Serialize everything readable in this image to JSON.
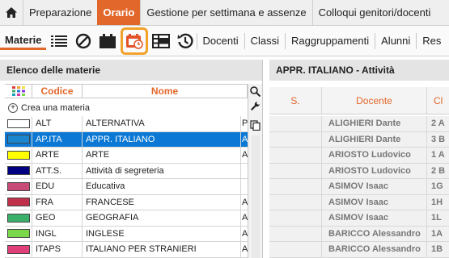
{
  "menu": {
    "home_icon": "home-icon",
    "items": [
      "Preparazione",
      "Orario",
      "Gestione per settimana e assenze",
      "Colloqui genitori/docenti"
    ],
    "active_index": 1
  },
  "toolbar": {
    "section_label": "Materie",
    "icons": [
      "list-icon",
      "ban-icon",
      "calendar-icon",
      "red-calendar-clock-icon",
      "grid-icon",
      "history-icon"
    ],
    "selected_icon_index": 3,
    "links": [
      "Docenti",
      "Classi",
      "Raggruppamenti",
      "Alunni",
      "Res"
    ]
  },
  "left_panel": {
    "title": "Elenco delle materie",
    "columns": {
      "code": "Codice",
      "name": "Nome"
    },
    "create_label": "Crea una materia",
    "rows": [
      {
        "color": "#ffffff",
        "code": "ALT",
        "name": "ALTERNATIVA",
        "extra": "P",
        "selected": false
      },
      {
        "color": "#1a86d0",
        "code": "AP.ITA",
        "name": "APPR. ITALIANO",
        "extra": "A",
        "selected": true
      },
      {
        "color": "#ffff00",
        "code": "ARTE",
        "name": "ARTE",
        "extra": "A",
        "selected": false
      },
      {
        "color": "#000080",
        "code": "ATT.S.",
        "name": "Attività di segreteria",
        "extra": "",
        "selected": false
      },
      {
        "color": "#c84a77",
        "code": "EDU",
        "name": "Educativa",
        "extra": "",
        "selected": false
      },
      {
        "color": "#c0304a",
        "code": "FRA",
        "name": "FRANCESE",
        "extra": "A",
        "selected": false
      },
      {
        "color": "#3cb06a",
        "code": "GEO",
        "name": "GEOGRAFIA",
        "extra": "A",
        "selected": false
      },
      {
        "color": "#7bd84a",
        "code": "INGL",
        "name": "INGLESE",
        "extra": "A",
        "selected": false
      },
      {
        "color": "#e0407a",
        "code": "ITAPS",
        "name": "ITALIANO PER STRANIERI",
        "extra": "A",
        "selected": false
      }
    ]
  },
  "right_panel": {
    "title": "APPR. ITALIANO - Attività",
    "columns": {
      "s": "S.",
      "docente": "Docente",
      "classe": "Cl"
    },
    "rows": [
      {
        "docente": "ALIGHIERI Dante",
        "classe": "2 A"
      },
      {
        "docente": "ALIGHIERI Dante",
        "classe": "3 B"
      },
      {
        "docente": "ARIOSTO Ludovico",
        "classe": "1 A"
      },
      {
        "docente": "ARIOSTO Ludovico",
        "classe": "2 B"
      },
      {
        "docente": "ASIMOV Isaac",
        "classe": "1G"
      },
      {
        "docente": "ASIMOV Isaac",
        "classe": "1H"
      },
      {
        "docente": "ASIMOV Isaac",
        "classe": "1L"
      },
      {
        "docente": "BARICCO Alessandro",
        "classe": "1A"
      },
      {
        "docente": "BARICCO Alessandro",
        "classe": "1B"
      }
    ]
  }
}
